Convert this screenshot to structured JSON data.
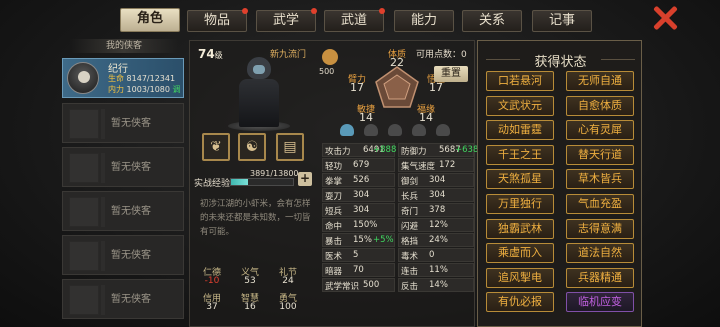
{
  "tabs": [
    {
      "label": "角色",
      "active": true,
      "dot": false
    },
    {
      "label": "物品",
      "dot": true
    },
    {
      "label": "武学",
      "dot": true
    },
    {
      "label": "武道",
      "dot": true
    },
    {
      "label": "能力",
      "dot": false
    },
    {
      "label": "关系",
      "dot": false
    },
    {
      "label": "记事",
      "dot": false
    }
  ],
  "left": {
    "header": "我的侠客",
    "selected": {
      "name": "纪行",
      "hp_label": "生命",
      "hp": "8147/12341",
      "mp_label": "内力",
      "mp": "1003/1080",
      "tag": "调"
    },
    "empty_label": "暂无侠客"
  },
  "char": {
    "level": "74",
    "level_unit": "级",
    "school": "新九流门",
    "exp_label": "实战经验",
    "exp_value": "3891/13800",
    "exp_fraction": 0.28,
    "desc": "初涉江湖的小虾米，会有怎样的未来还都是未知数，一切皆有可能。"
  },
  "virtues": {
    "labels": [
      "仁德",
      "义气",
      "礼节"
    ],
    "values": [
      "-10",
      "53",
      "24"
    ],
    "labels2": [
      "信用",
      "智慧",
      "勇气"
    ],
    "values2": [
      "37",
      "16",
      "100"
    ]
  },
  "attrs": {
    "points_label": "可用点数：",
    "points": "0",
    "reset": "重置",
    "fame": "500",
    "items": [
      {
        "label": "体质",
        "value": "22"
      },
      {
        "label": "悟性",
        "value": "17"
      },
      {
        "label": "福缘",
        "value": "14"
      },
      {
        "label": "敏捷",
        "value": "14"
      },
      {
        "label": "臂力",
        "value": "17"
      }
    ]
  },
  "stats": [
    [
      "攻击力",
      "6491",
      "+888",
      "防御力",
      "5687",
      "+638"
    ],
    [
      "轻功",
      "679",
      "",
      "集气速度",
      "172",
      ""
    ],
    [
      "拳掌",
      "526",
      "",
      "御剑",
      "304",
      ""
    ],
    [
      "耍刀",
      "304",
      "",
      "长兵",
      "304",
      ""
    ],
    [
      "短兵",
      "304",
      "",
      "奇门",
      "378",
      ""
    ],
    [
      "命中",
      "150%",
      "",
      "闪避",
      "12%",
      ""
    ],
    [
      "暴击",
      "15%",
      "+5%",
      "格挡",
      "24%",
      ""
    ],
    [
      "医术",
      "5",
      "",
      "毒术",
      "0",
      ""
    ],
    [
      "暗器",
      "70",
      "",
      "连击",
      "11%",
      ""
    ],
    [
      "武学常识",
      "500",
      "",
      "反击",
      "14%",
      ""
    ]
  ],
  "states": {
    "title": "获得状态",
    "items": [
      "口若悬河",
      "无师自通",
      "文武状元",
      "自愈体质",
      "动如雷霆",
      "心有灵犀",
      "千王之王",
      "替天行道",
      "天煞孤星",
      "草木皆兵",
      "万里独行",
      "气血充盈",
      "独霸武林",
      "志得意满",
      "乘虚而入",
      "道法自然",
      "追风掣电",
      "兵器精通",
      "有仇必报",
      "临机应变"
    ]
  }
}
